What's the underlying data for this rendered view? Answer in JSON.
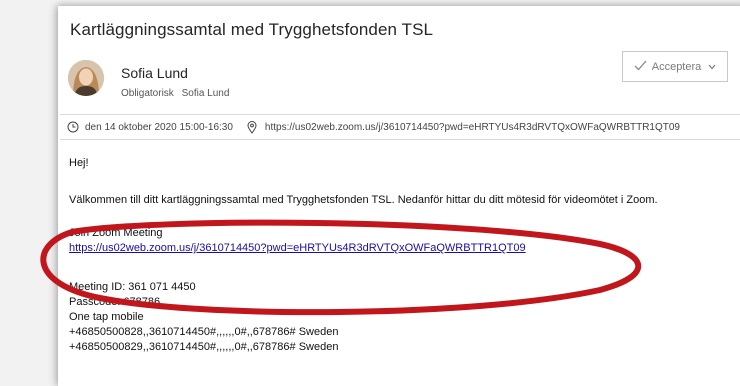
{
  "email": {
    "subject": "Kartläggningssamtal med Trygghetsfonden TSL",
    "sender": "Sofia Lund",
    "attendance_type": "Obligatorisk",
    "attendee": "Sofia Lund",
    "accept_label": "Acceptera",
    "when": "den 14 oktober 2020 15:00-16:30",
    "location": "https://us02web.zoom.us/j/3610714450?pwd=eHRTYUs4R3dRVTQxOWFaQWRBTTR1QT09"
  },
  "body": {
    "greeting": "Hej!",
    "welcome": "Välkommen till ditt kartläggningssamtal med Trygghetsfonden TSL. Nedanför hittar du ditt mötesid för videomötet i Zoom.",
    "join_heading": "Join Zoom Meeting",
    "join_link": "https://us02web.zoom.us/j/3610714450?pwd=eHRTYUs4R3dRVTQxOWFaQWRBTTR1QT09",
    "meeting_id": "Meeting ID: 361 071 4450",
    "passcode": "Passcode: 678786",
    "one_tap": "One tap mobile",
    "phone_1": "+46850500828,,3610714450#,,,,,,0#,,678786# Sweden",
    "phone_2": "+46850500829,,3610714450#,,,,,,0#,,678786# Sweden"
  },
  "icons": {
    "clock": "clock-icon",
    "location": "location-pin-icon",
    "check": "checkmark-icon",
    "caret": "chevron-down-icon"
  },
  "colors": {
    "link": "#1a0dab",
    "highlight_ellipse": "#c0161c"
  }
}
